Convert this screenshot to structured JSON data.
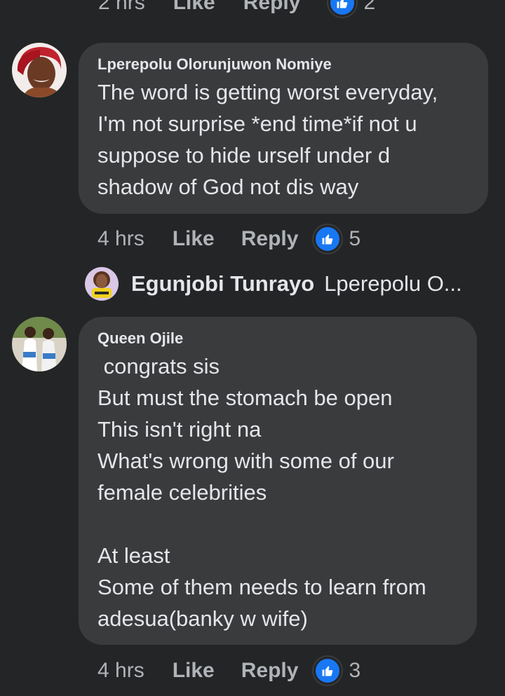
{
  "top_partial": {
    "time": "2 hrs",
    "like_label": "Like",
    "reply_label": "Reply",
    "reaction_count": "2"
  },
  "comments": [
    {
      "author": "Lperepolu Olorunjuwon Nomiye",
      "text": "The word is getting worst everyday,\nI'm not surprise *end time*if not u\nsuppose to hide urself under d\nshadow of God not dis way",
      "time": "4 hrs",
      "like_label": "Like",
      "reply_label": "Reply",
      "reaction_icon": "thumbs-up-icon",
      "reaction_count": "5"
    },
    {
      "author": "Queen Ojile",
      "text": " congrats sis\nBut must the stomach be open\nThis isn't right na\nWhat's wrong with some of our\nfemale celebrities\n\nAt least\nSome of them needs to learn from\nadesua(banky w wife)",
      "time": "4 hrs",
      "like_label": "Like",
      "reply_label": "Reply",
      "reaction_icon": "thumbs-up-icon",
      "reaction_count": "3"
    }
  ],
  "reply_preview": {
    "author": "Egunjobi Tunrayo",
    "preview_text": "Lperepolu O..."
  },
  "colors": {
    "background": "#242526",
    "bubble": "#3a3b3c",
    "text_primary": "#e4e6eb",
    "text_secondary": "#b0b3b8",
    "like_blue": "#1877f2"
  }
}
